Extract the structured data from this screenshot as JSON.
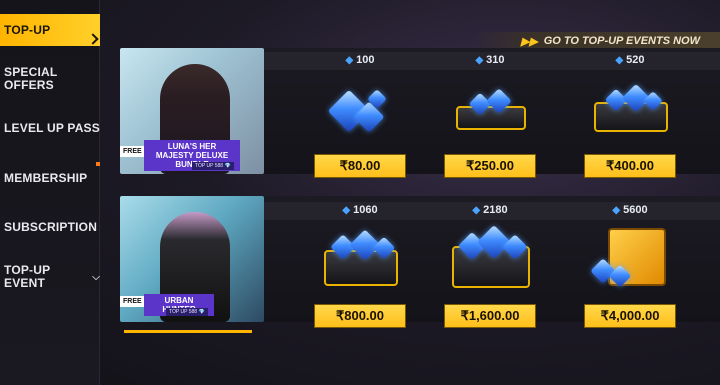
{
  "sidebar": {
    "items": [
      {
        "label": "TOP-UP",
        "active": true
      },
      {
        "label": "SPECIAL OFFERS"
      },
      {
        "label": "LEVEL UP PASS"
      },
      {
        "label": "MEMBERSHIP"
      },
      {
        "label": "SUBSCRIPTION"
      },
      {
        "label": "TOP-UP EVENT",
        "chevron": "chevron-down-icon"
      }
    ]
  },
  "events_link": {
    "label": "GO TO TOP-UP EVENTS NOW",
    "icon": "arrow-right-icon"
  },
  "bundles": [
    {
      "tag": "FREE",
      "name": "LUNA'S HER MAJESTY DELUXE BUNDLE",
      "sub": "TOP UP 588 💎"
    },
    {
      "tag": "FREE",
      "name": "URBAN HUNTER",
      "sub": "TOP UP 588 💎"
    }
  ],
  "packages": [
    {
      "diamonds": "100",
      "price": "₹80.00"
    },
    {
      "diamonds": "310",
      "price": "₹250.00"
    },
    {
      "diamonds": "520",
      "price": "₹400.00"
    },
    {
      "diamonds": "1060",
      "price": "₹800.00"
    },
    {
      "diamonds": "2180",
      "price": "₹1,600.00"
    },
    {
      "diamonds": "5600",
      "price": "₹4,000.00"
    }
  ],
  "colors": {
    "accent": "#ffb400",
    "diamond": "#4aa3ff",
    "banner_purple": "#5b35c9"
  }
}
